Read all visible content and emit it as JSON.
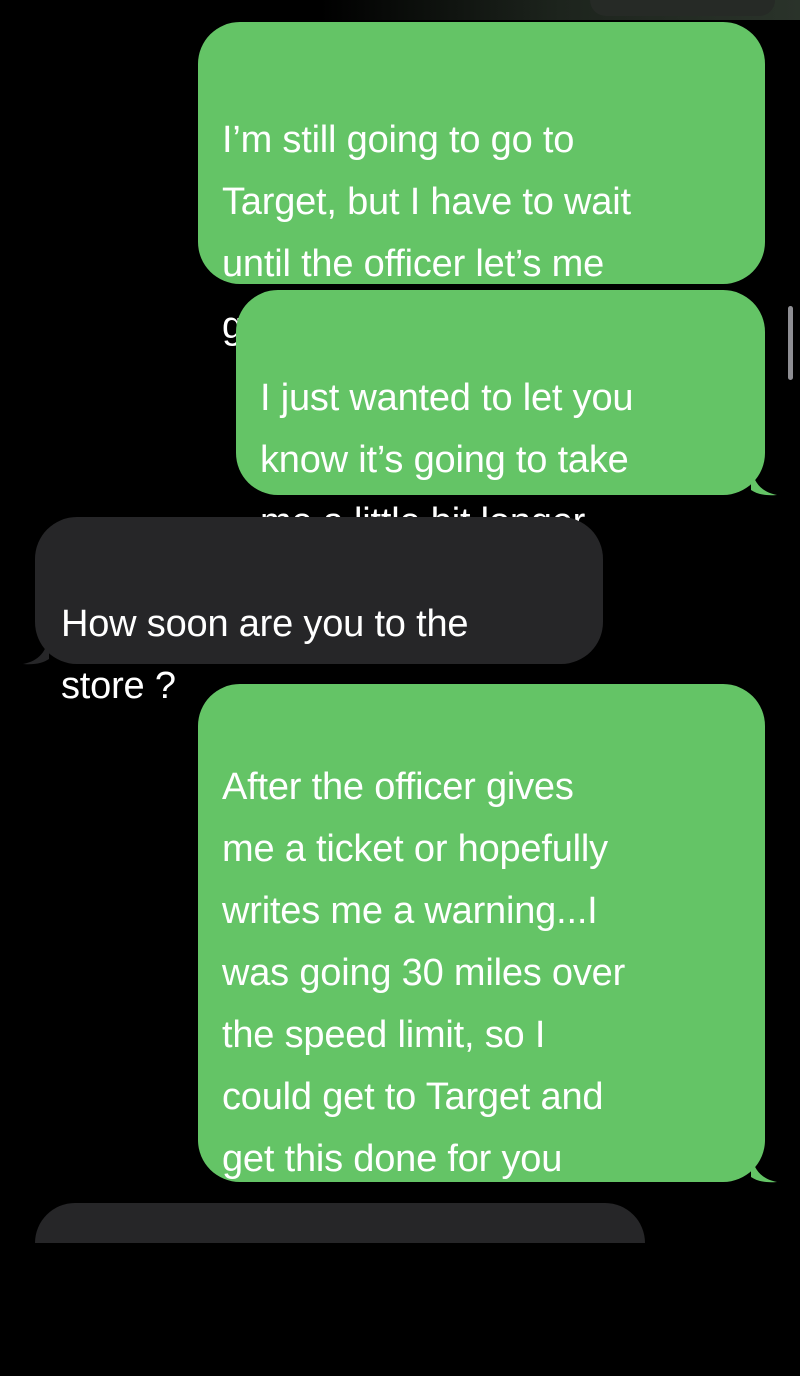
{
  "conversation": {
    "messages": [
      {
        "sender": "me",
        "text": "I’m still going to go to\nTarget, but I have to wait\nuntil the officer let’s me\ngo"
      },
      {
        "sender": "me",
        "text": "I just wanted to let you\nknow it’s going to take\nme a little bit longer"
      },
      {
        "sender": "other",
        "text": "How soon are you to the\nstore ?"
      },
      {
        "sender": "me",
        "text": "After the officer gives\nme a ticket or hopefully\nwrites me a warning...I\nwas going 30 miles over\nthe speed limit, so I\ncould get to Target and\nget this done for you\nquickly"
      }
    ]
  },
  "colors": {
    "sent_bubble": "#64c466",
    "received_bubble": "#262628",
    "background": "#000000",
    "text": "#ffffff"
  }
}
